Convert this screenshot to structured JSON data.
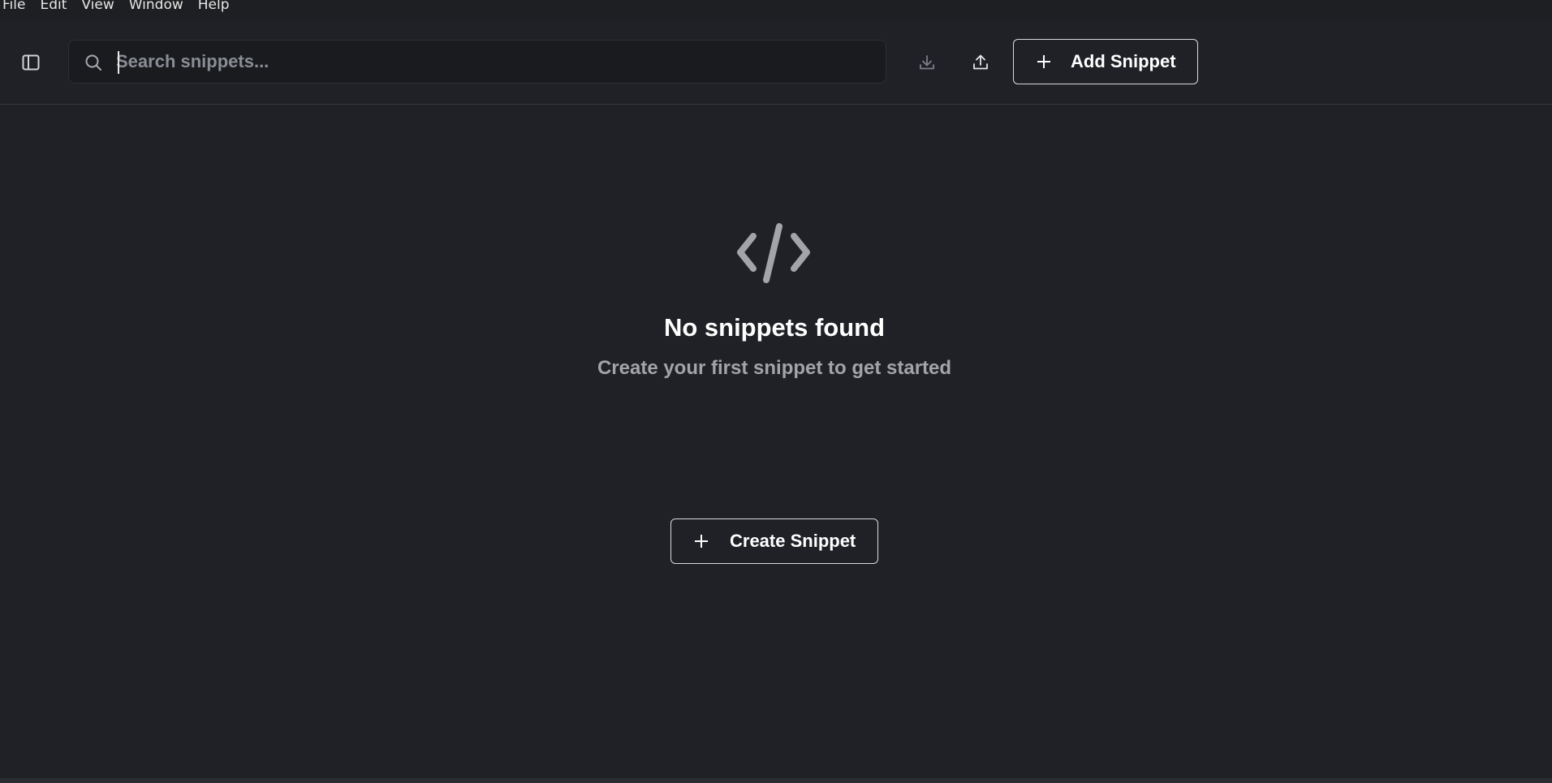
{
  "menubar": {
    "items": [
      "File",
      "Edit",
      "View",
      "Window",
      "Help"
    ]
  },
  "toolbar": {
    "sidebar_toggle_icon": "sidebar-panel-icon",
    "search": {
      "placeholder": "Search snippets...",
      "value": "",
      "icon": "search-icon"
    },
    "import_icon": "download-icon",
    "export_icon": "upload-icon",
    "add_button_label": "Add Snippet"
  },
  "empty_state": {
    "icon": "code-icon",
    "title": "No snippets found",
    "subtitle": "Create your first snippet to get started",
    "create_button_label": "Create Snippet"
  },
  "colors": {
    "background": "#1f2126",
    "menubar": "#1e1f22",
    "muted_text": "#a2a4aa",
    "border": "#d9d9d9"
  }
}
